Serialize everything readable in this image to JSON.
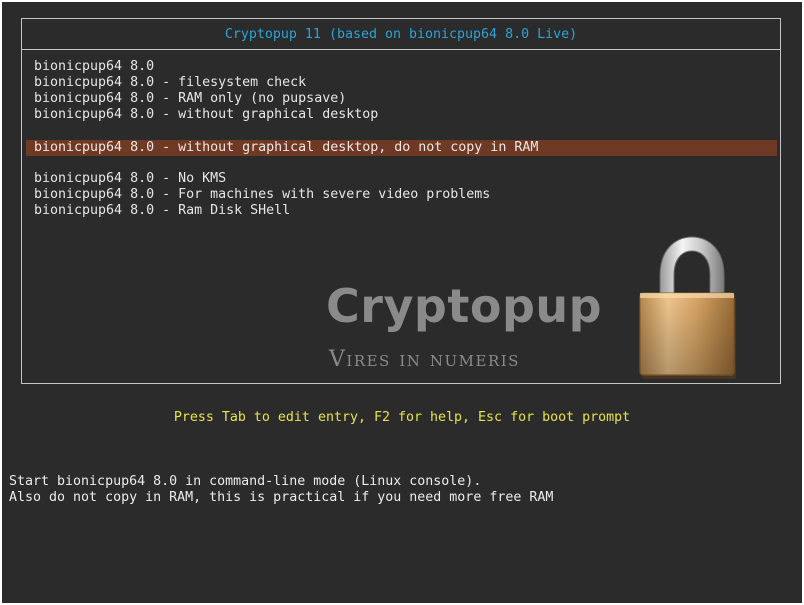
{
  "menu": {
    "title": "Cryptopup 11 (based on bionicpup64 8.0 Live)",
    "entries": [
      "bionicpup64 8.0",
      "bionicpup64 8.0 - filesystem check",
      "bionicpup64 8.0 - RAM only (no pupsave)",
      "bionicpup64 8.0 - without graphical desktop",
      "bionicpup64 8.0 - without graphical desktop, do not copy in RAM",
      "bionicpup64 8.0 - No KMS",
      "bionicpup64 8.0 - For machines with severe video problems",
      "bionicpup64 8.0 - Ram Disk SHell"
    ],
    "selected_index": 4
  },
  "branding": {
    "logo_text": "Cryptopup",
    "motto": "Vires in numeris",
    "lock_icon": "padlock-icon"
  },
  "hint": "Press Tab to edit entry, F2 for help, Esc for boot prompt",
  "help": {
    "line1": "Start bionicpup64 8.0 in command-line mode (Linux console).",
    "line2": "Also do not copy in RAM, this is practical if you need more free RAM"
  },
  "colors": {
    "background": "#2b2b2b",
    "title": "#2aa4d8",
    "selected_bg": "#6e3a25",
    "hint": "#e8e34a"
  }
}
